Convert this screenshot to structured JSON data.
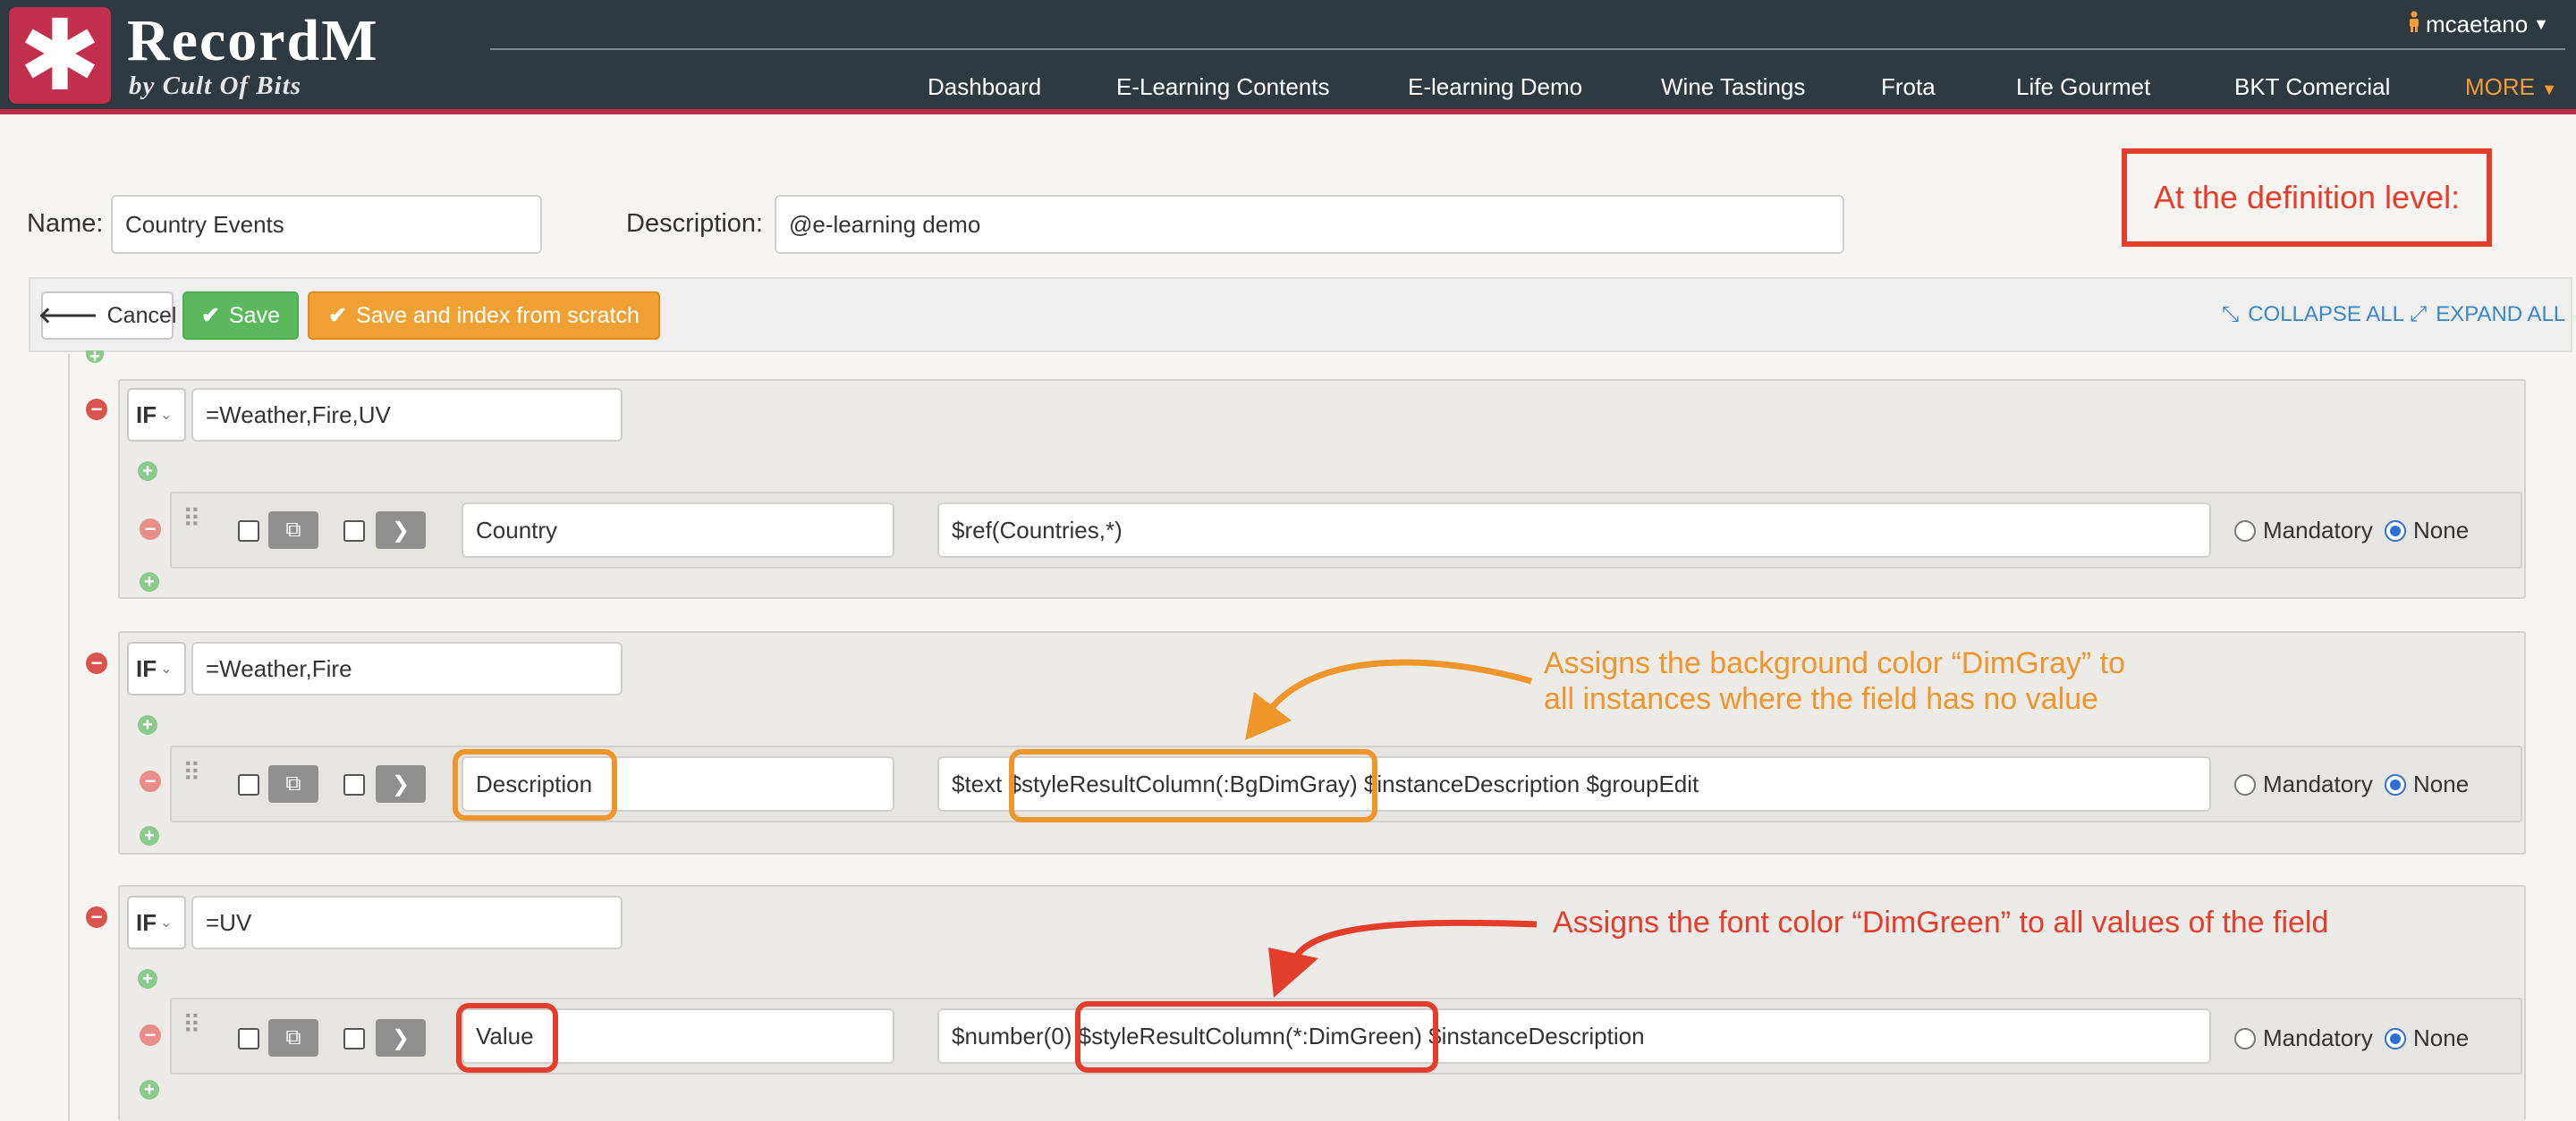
{
  "header": {
    "logo_symbol": "✱",
    "title": "RecordM",
    "subtitle": "by Cult Of Bits",
    "user": "mcaetano",
    "nav": [
      "Dashboard",
      "E-Learning Contents",
      "E-learning Demo",
      "Wine Tastings",
      "Frota",
      "Life Gourmet",
      "BKT Comercial"
    ],
    "more_label": "MORE",
    "colors": {
      "bar": "#2e3a40",
      "brand": "#c2304e",
      "more": "#f39c3a"
    }
  },
  "form": {
    "name_label": "Name:",
    "name_value": "Country Events",
    "description_label": "Description:",
    "description_value": "@e-learning demo"
  },
  "toolbar": {
    "cancel_label": "Cancel",
    "save_label": "Save",
    "save_index_label": "Save and index from scratch",
    "collapse_all": "COLLAPSE ALL",
    "expand_all": "EXPAND ALL"
  },
  "callouts": {
    "definition_level": "At the definition level:",
    "dimgray_line1": "Assigns the background color “DimGray” to",
    "dimgray_line2": "all instances where the field has no value",
    "dimgreen": "Assigns the font color “DimGreen” to all values of the field",
    "colors": {
      "orange": "#f0952a",
      "red": "#e43d2b"
    }
  },
  "groups": [
    {
      "condition_type": "IF",
      "condition": "=Weather,Fire,UV",
      "field": {
        "name": "Country",
        "description_value": "$ref(Countries,*)",
        "mandatory_label": "Mandatory",
        "none_label": "None",
        "selected": "None"
      }
    },
    {
      "condition_type": "IF",
      "condition": "=Weather,Fire",
      "field": {
        "name": "Description",
        "description_value": "$text $styleResultColumn(:BgDimGray) $instanceDescription $groupEdit",
        "mandatory_label": "Mandatory",
        "none_label": "None",
        "selected": "None"
      }
    },
    {
      "condition_type": "IF",
      "condition": "=UV",
      "field": {
        "name": "Value",
        "description_value": "$number(0) $styleResultColumn(*:DimGreen) $instanceDescription",
        "mandatory_label": "Mandatory",
        "none_label": "None",
        "selected": "None"
      }
    }
  ]
}
